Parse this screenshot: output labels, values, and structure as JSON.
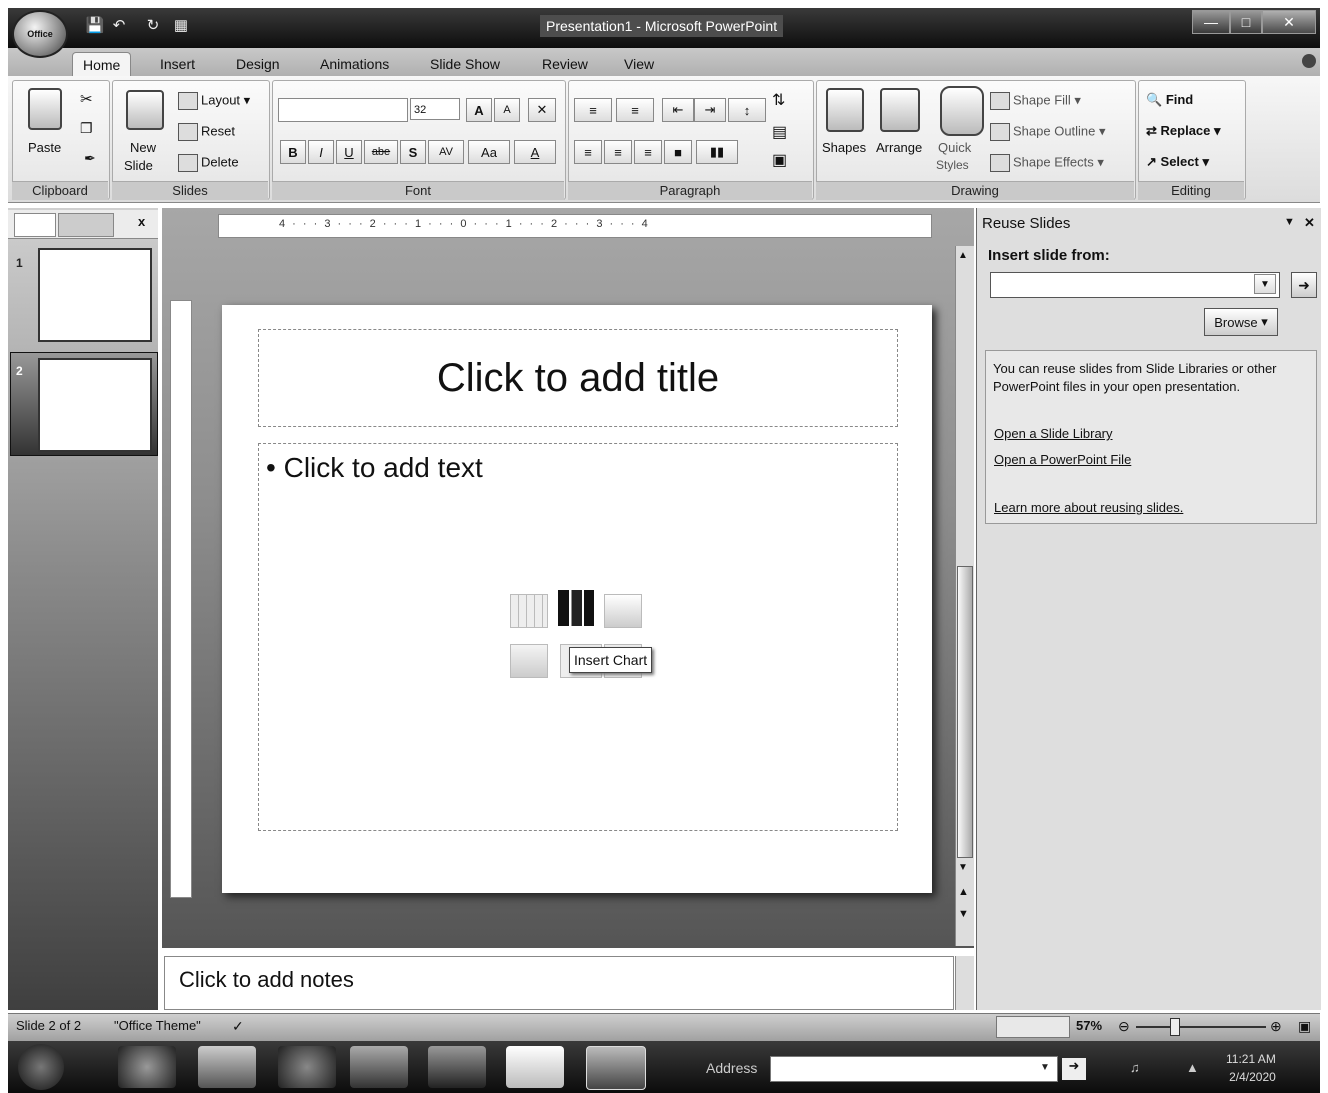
{
  "window": {
    "title": "Presentation1 - Microsoft PowerPoint",
    "office_button": "Office"
  },
  "quick_access": [
    "save-icon",
    "undo-icon",
    "redo-icon",
    "new-slide-icon"
  ],
  "tabs": [
    "Home",
    "Insert",
    "Design",
    "Animations",
    "Slide Show",
    "Review",
    "View"
  ],
  "ribbon": {
    "clipboard": {
      "paste": "Paste",
      "label": "Clipboard"
    },
    "slides": {
      "new_slide_1": "New",
      "new_slide_2": "Slide",
      "layout": "Layout",
      "reset": "Reset",
      "delete": "Delete",
      "label": "Slides"
    },
    "font": {
      "size": "32",
      "bold": "B",
      "italic": "I",
      "underline": "U",
      "strike": "abe",
      "shadow": "S",
      "spacing": "AV",
      "case": "Aa",
      "grow": "A",
      "shrink": "A",
      "color": "A",
      "label": "Font"
    },
    "paragraph": {
      "label": "Paragraph"
    },
    "drawing": {
      "shapes": "Shapes",
      "arrange": "Arrange",
      "quick_styles_1": "Quick",
      "quick_styles_2": "Styles",
      "shape_fill": "Shape Fill",
      "shape_outline": "Shape Outline",
      "shape_effects": "Shape Effects",
      "label": "Drawing"
    },
    "editing": {
      "find": "Find",
      "replace": "Replace",
      "select": "Select",
      "label": "Editing"
    }
  },
  "slides_pane": {
    "thumb1_num": "1",
    "thumb2_num": "2",
    "close": "x"
  },
  "ruler": "4 · · · 3 · · · 2 · · · 1 · · · 0 · · · 1 · · · 2 · · · 3 · · · 4",
  "slide": {
    "title_placeholder": "Click to add title",
    "body_placeholder": "Click to add text",
    "bullet": "•"
  },
  "tooltip": "Insert Chart",
  "notes": "Click to add notes",
  "task_pane": {
    "title": "Reuse Slides",
    "insert_from": "Insert slide from:",
    "browse": "Browse",
    "info": "You can reuse slides from Slide Libraries or other PowerPoint files in your open presentation.",
    "link1": "Open a Slide Library",
    "link2": "Open a PowerPoint File",
    "link3": "Learn more about reusing slides."
  },
  "status": {
    "slide": "Slide 2 of 2",
    "theme": "\"Office Theme\"",
    "zoom": "57%"
  },
  "taskbar": {
    "address_label": "Address",
    "time": "11:21 AM",
    "date": "2/4/2020"
  }
}
